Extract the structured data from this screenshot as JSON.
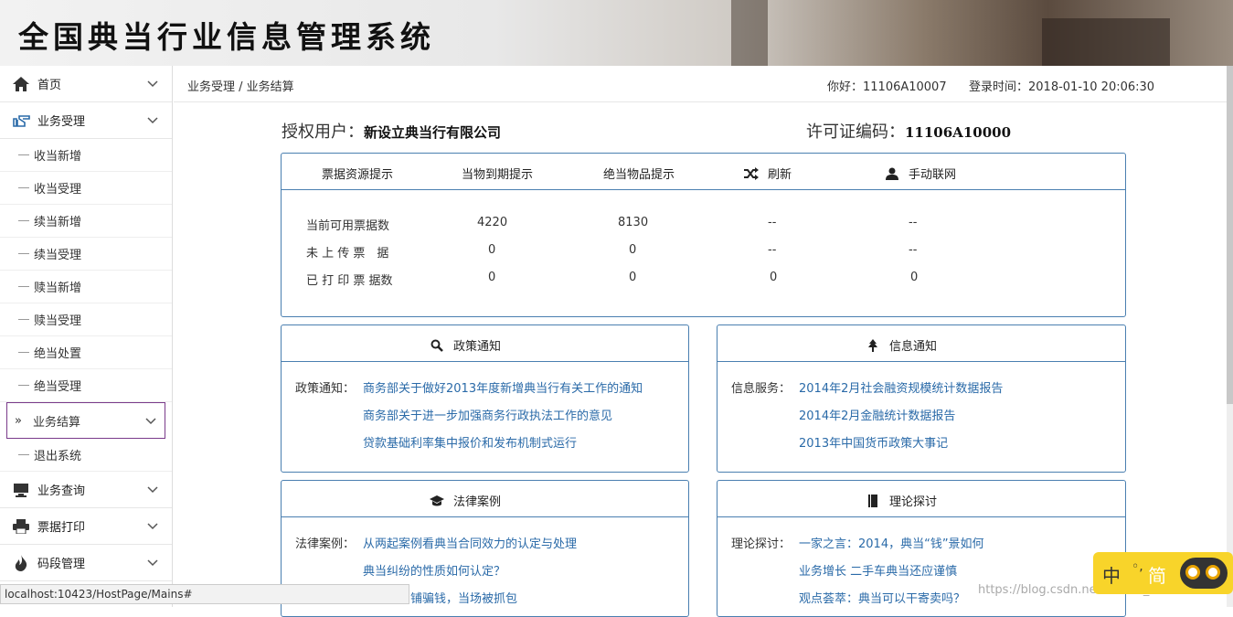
{
  "header": {
    "title": "全国典当行业信息管理系统"
  },
  "sidebar": {
    "groups": [
      {
        "label": "首页",
        "icon": "home-icon"
      },
      {
        "label": "业务受理",
        "icon": "hand-point-icon"
      }
    ],
    "subitems": [
      {
        "label": "收当新增"
      },
      {
        "label": "收当受理"
      },
      {
        "label": "续当新增"
      },
      {
        "label": "续当受理"
      },
      {
        "label": "赎当新增"
      },
      {
        "label": "赎当受理"
      },
      {
        "label": "绝当处置"
      },
      {
        "label": "绝当受理"
      },
      {
        "label": "业务结算",
        "active": true,
        "arrow": "»"
      },
      {
        "label": "退出系统"
      }
    ],
    "groups_bottom": [
      {
        "label": "业务查询",
        "icon": "monitor-icon"
      },
      {
        "label": "票据打印",
        "icon": "printer-icon"
      },
      {
        "label": "码段管理",
        "icon": "fire-icon"
      }
    ]
  },
  "topbar": {
    "breadcrumb": "业务受理 / 业务结算",
    "hello": "你好：11106A10007",
    "login_time": "登录时间：2018-01-10 20:06:30"
  },
  "info": {
    "user_label": "授权用户：",
    "user_value": "新设立典当行有限公司",
    "license_label": "许可证编码：",
    "license_value": "11106A10000"
  },
  "stats_panel": {
    "headers": [
      "票据资源提示",
      "当物到期提示",
      "绝当物品提示",
      "刷新",
      "手动联网"
    ],
    "rows": [
      [
        "当前可用票据数",
        "4220",
        "8130",
        "--",
        "--"
      ],
      [
        "未 上 传 票　据",
        "0",
        "0",
        "--",
        "--"
      ],
      [
        "已 打 印 票 据数",
        "0",
        "0",
        "0",
        "0"
      ]
    ]
  },
  "policy": {
    "title": "政策通知",
    "label": "政策通知：",
    "links": [
      "商务部关于做好2013年度新增典当行有关工作的通知",
      "商务部关于进一步加强商务行政执法工作的意见",
      "贷款基础利率集中报价和发布机制式运行"
    ]
  },
  "infonotice": {
    "title": "信息通知",
    "label": "信息服务：",
    "links": [
      "2014年2月社会融资规模统计数据报告",
      "2014年2月金融统计数据报告",
      "2013年中国货币政策大事记"
    ]
  },
  "law": {
    "title": "法律案例",
    "label": "法律案例：",
    "links": [
      "从两起案例看典当合同效力的认定与处理",
      "典当纠纷的性质如何认定？",
      "钻石赴当铺骗钱，当场被抓包"
    ]
  },
  "theory": {
    "title": "理论探讨",
    "label": "理论探讨：",
    "links": [
      "一家之言：2014，典当“钱”景如何",
      "业务增长 二手车典当还应谨慎",
      "观点荟萃：典当可以干寄卖吗？"
    ]
  },
  "statusbar": {
    "url": "localhost:10423/HostPage/Mains#"
  },
  "ime": {
    "zh": "中",
    "mid": "◦,",
    "jian": "简"
  },
  "watermark": "https://blog.csdn.net/weixin_43826111",
  "colors": {
    "panel_border": "#4a7fb0",
    "link": "#2a6aa8",
    "active_border": "#7a3a8a"
  }
}
